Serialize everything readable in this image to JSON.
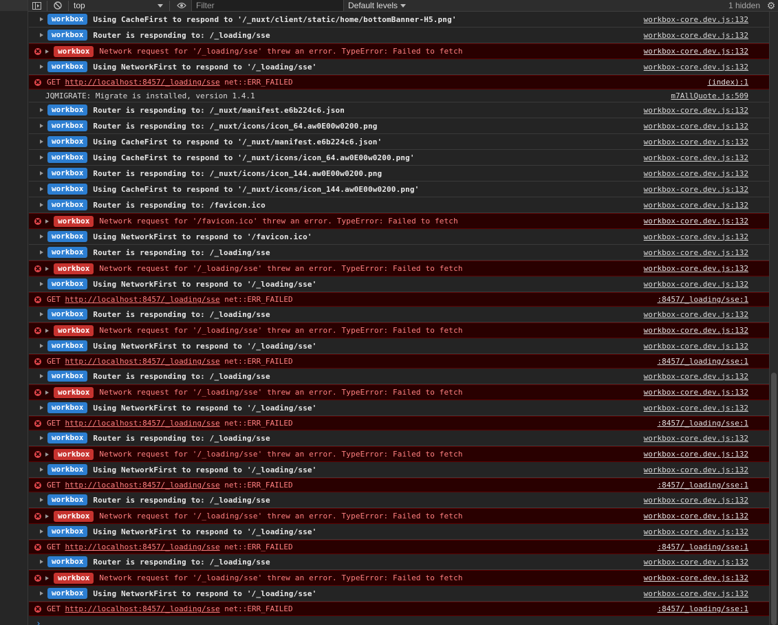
{
  "toolbar": {
    "context": "top",
    "filter_placeholder": "Filter",
    "levels": "Default levels",
    "hidden": "1 hidden"
  },
  "rows": [
    {
      "kind": "info",
      "badge": "workbox",
      "text": "Using CacheFirst to respond to '/_nuxt/client/static/home/bottomBanner-H5.png'",
      "src": "workbox-core.dev.js:132"
    },
    {
      "kind": "info",
      "badge": "workbox",
      "text": "Router is responding to: /_loading/sse",
      "src": "workbox-core.dev.js:132"
    },
    {
      "kind": "err",
      "badge": "workbox",
      "text": "Network request for '/_loading/sse' threw an error. TypeError: Failed to fetch",
      "src": "workbox-core.dev.js:132"
    },
    {
      "kind": "info",
      "badge": "workbox",
      "text": "Using NetworkFirst to respond to '/_loading/sse'",
      "src": "workbox-core.dev.js:132"
    },
    {
      "kind": "get",
      "method": "GET",
      "url": "http://localhost:8457/_loading/sse",
      "status": "net::ERR_FAILED",
      "src": "(index):1"
    },
    {
      "kind": "jq",
      "text": "JQMIGRATE: Migrate is installed, version 1.4.1",
      "src": "m7AllQuote.js:509"
    },
    {
      "kind": "info",
      "badge": "workbox",
      "text": "Router is responding to: /_nuxt/manifest.e6b224c6.json",
      "src": "workbox-core.dev.js:132"
    },
    {
      "kind": "info",
      "badge": "workbox",
      "text": "Router is responding to: /_nuxt/icons/icon_64.aw0E00w0200.png",
      "src": "workbox-core.dev.js:132"
    },
    {
      "kind": "info",
      "badge": "workbox",
      "text": "Using CacheFirst to respond to '/_nuxt/manifest.e6b224c6.json'",
      "src": "workbox-core.dev.js:132"
    },
    {
      "kind": "info",
      "badge": "workbox",
      "text": "Using CacheFirst to respond to '/_nuxt/icons/icon_64.aw0E00w0200.png'",
      "src": "workbox-core.dev.js:132"
    },
    {
      "kind": "info",
      "badge": "workbox",
      "text": "Router is responding to: /_nuxt/icons/icon_144.aw0E00w0200.png",
      "src": "workbox-core.dev.js:132"
    },
    {
      "kind": "info",
      "badge": "workbox",
      "text": "Using CacheFirst to respond to '/_nuxt/icons/icon_144.aw0E00w0200.png'",
      "src": "workbox-core.dev.js:132"
    },
    {
      "kind": "info",
      "badge": "workbox",
      "text": "Router is responding to: /favicon.ico",
      "src": "workbox-core.dev.js:132"
    },
    {
      "kind": "err",
      "badge": "workbox",
      "text": "Network request for '/favicon.ico' threw an error. TypeError: Failed to fetch",
      "src": "workbox-core.dev.js:132"
    },
    {
      "kind": "info",
      "badge": "workbox",
      "text": "Using NetworkFirst to respond to '/favicon.ico'",
      "src": "workbox-core.dev.js:132"
    },
    {
      "kind": "info",
      "badge": "workbox",
      "text": "Router is responding to: /_loading/sse",
      "src": "workbox-core.dev.js:132"
    },
    {
      "kind": "err",
      "badge": "workbox",
      "text": "Network request for '/_loading/sse' threw an error. TypeError: Failed to fetch",
      "src": "workbox-core.dev.js:132"
    },
    {
      "kind": "info",
      "badge": "workbox",
      "text": "Using NetworkFirst to respond to '/_loading/sse'",
      "src": "workbox-core.dev.js:132"
    },
    {
      "kind": "get",
      "method": "GET",
      "url": "http://localhost:8457/_loading/sse",
      "status": "net::ERR_FAILED",
      "src": ":8457/_loading/sse:1"
    },
    {
      "kind": "info",
      "badge": "workbox",
      "text": "Router is responding to: /_loading/sse",
      "src": "workbox-core.dev.js:132"
    },
    {
      "kind": "err",
      "badge": "workbox",
      "text": "Network request for '/_loading/sse' threw an error. TypeError: Failed to fetch",
      "src": "workbox-core.dev.js:132"
    },
    {
      "kind": "info",
      "badge": "workbox",
      "text": "Using NetworkFirst to respond to '/_loading/sse'",
      "src": "workbox-core.dev.js:132"
    },
    {
      "kind": "get",
      "method": "GET",
      "url": "http://localhost:8457/_loading/sse",
      "status": "net::ERR_FAILED",
      "src": ":8457/_loading/sse:1"
    },
    {
      "kind": "info",
      "badge": "workbox",
      "text": "Router is responding to: /_loading/sse",
      "src": "workbox-core.dev.js:132"
    },
    {
      "kind": "err",
      "badge": "workbox",
      "text": "Network request for '/_loading/sse' threw an error. TypeError: Failed to fetch",
      "src": "workbox-core.dev.js:132"
    },
    {
      "kind": "info",
      "badge": "workbox",
      "text": "Using NetworkFirst to respond to '/_loading/sse'",
      "src": "workbox-core.dev.js:132"
    },
    {
      "kind": "get",
      "method": "GET",
      "url": "http://localhost:8457/_loading/sse",
      "status": "net::ERR_FAILED",
      "src": ":8457/_loading/sse:1"
    },
    {
      "kind": "info",
      "badge": "workbox",
      "text": "Router is responding to: /_loading/sse",
      "src": "workbox-core.dev.js:132"
    },
    {
      "kind": "err",
      "badge": "workbox",
      "text": "Network request for '/_loading/sse' threw an error. TypeError: Failed to fetch",
      "src": "workbox-core.dev.js:132"
    },
    {
      "kind": "info",
      "badge": "workbox",
      "text": "Using NetworkFirst to respond to '/_loading/sse'",
      "src": "workbox-core.dev.js:132"
    },
    {
      "kind": "get",
      "method": "GET",
      "url": "http://localhost:8457/_loading/sse",
      "status": "net::ERR_FAILED",
      "src": ":8457/_loading/sse:1"
    },
    {
      "kind": "info",
      "badge": "workbox",
      "text": "Router is responding to: /_loading/sse",
      "src": "workbox-core.dev.js:132"
    },
    {
      "kind": "err",
      "badge": "workbox",
      "text": "Network request for '/_loading/sse' threw an error. TypeError: Failed to fetch",
      "src": "workbox-core.dev.js:132"
    },
    {
      "kind": "info",
      "badge": "workbox",
      "text": "Using NetworkFirst to respond to '/_loading/sse'",
      "src": "workbox-core.dev.js:132"
    },
    {
      "kind": "get",
      "method": "GET",
      "url": "http://localhost:8457/_loading/sse",
      "status": "net::ERR_FAILED",
      "src": ":8457/_loading/sse:1"
    },
    {
      "kind": "info",
      "badge": "workbox",
      "text": "Router is responding to: /_loading/sse",
      "src": "workbox-core.dev.js:132"
    },
    {
      "kind": "err",
      "badge": "workbox",
      "text": "Network request for '/_loading/sse' threw an error. TypeError: Failed to fetch",
      "src": "workbox-core.dev.js:132"
    },
    {
      "kind": "info",
      "badge": "workbox",
      "text": "Using NetworkFirst to respond to '/_loading/sse'",
      "src": "workbox-core.dev.js:132"
    },
    {
      "kind": "get",
      "method": "GET",
      "url": "http://localhost:8457/_loading/sse",
      "status": "net::ERR_FAILED",
      "src": ":8457/_loading/sse:1"
    }
  ],
  "prompt": "›",
  "colors": {
    "badge_info": "#2d7fd2",
    "badge_error": "#c7332f",
    "error_text": "#ff8080",
    "error_bg": "#290000",
    "prompt": "#4aa3ff"
  }
}
